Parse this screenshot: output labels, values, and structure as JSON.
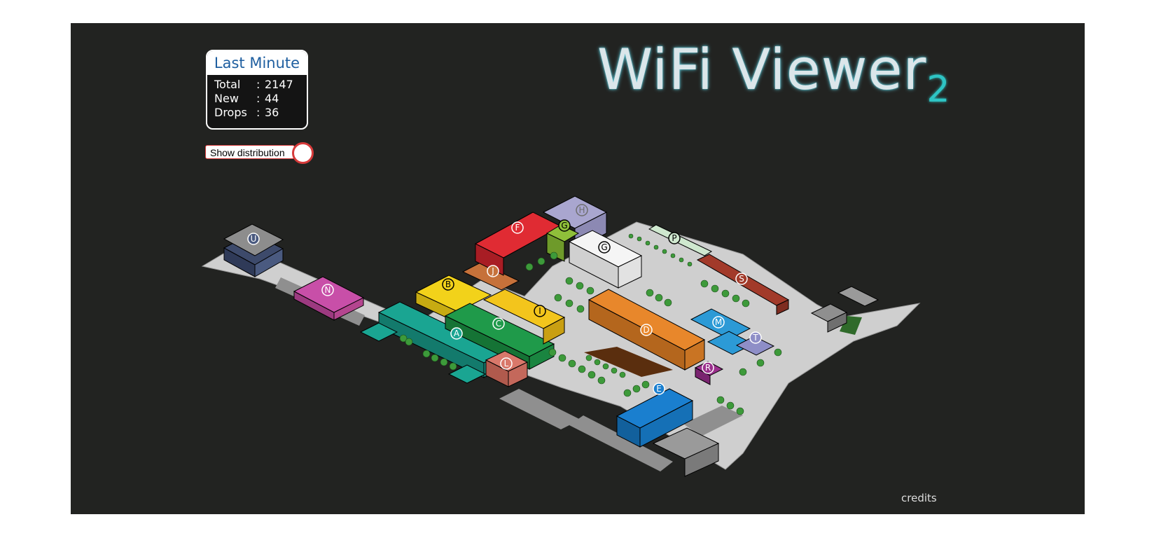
{
  "app": {
    "title": "WiFi Viewer",
    "title_sub": "2"
  },
  "stats": {
    "title": "Last Minute",
    "rows": [
      {
        "label": "Total",
        "sep": ":",
        "value": "2147"
      },
      {
        "label": "New",
        "sep": ":",
        "value": "44"
      },
      {
        "label": "Drops",
        "sep": ":",
        "value": "36"
      }
    ]
  },
  "toggle": {
    "label": "Show distribution",
    "state": "off"
  },
  "footer": {
    "credits": "credits"
  },
  "buildings": {
    "U": "U",
    "N": "N",
    "A": "A",
    "B": "B",
    "C": "C",
    "D": "D",
    "E": "E",
    "F": "F",
    "G1": "G",
    "G2": "G",
    "H": "H",
    "I": "I",
    "J": "J",
    "L": "L",
    "M": "M",
    "P": "P",
    "R": "R",
    "S": "S",
    "T": "T"
  },
  "colors": {
    "background": "#222321",
    "ground": "#cfcfcf",
    "road": "#8a8a8a",
    "U": "#3d4a6b",
    "N": "#c84fa8",
    "A": "#1aa592",
    "B": "#f2d21a",
    "C": "#1f9a4a",
    "D": "#e8872b",
    "E": "#1a7fcf",
    "F": "#e02b33",
    "G_green": "#8fbf3a",
    "G_white": "#f5f5f5",
    "H": "#a9a6cf",
    "I": "#f3c51c",
    "J": "#c6713a",
    "L": "#d9786a",
    "M": "#2c9ad6",
    "P": "#cfe8cf",
    "R": "#9a2f8c",
    "S": "#a23a2a",
    "T": "#8e8ec7",
    "tree": "#3d9a3a"
  }
}
